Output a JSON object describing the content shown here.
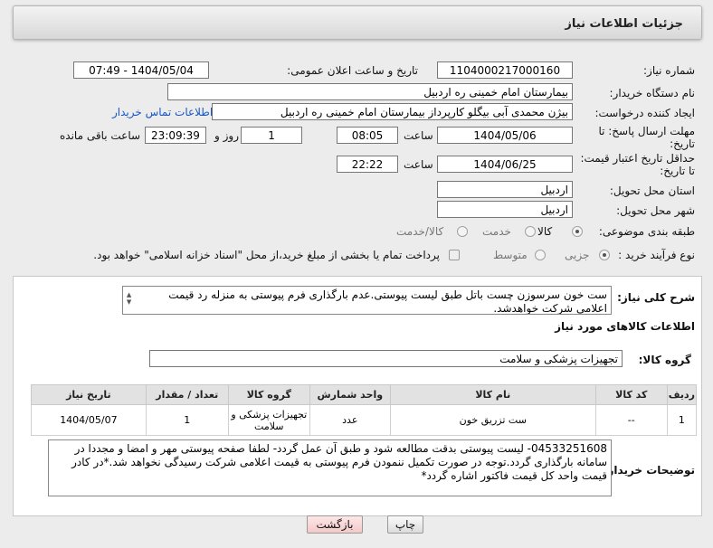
{
  "header": {
    "title": "جزئیات اطلاعات نیاز"
  },
  "fields": {
    "need_number_label": "شماره نیاز:",
    "need_number": "1104000217000160",
    "announce_label": "تاریخ و ساعت اعلان عمومی:",
    "announce_value": "1404/05/04 - 07:49",
    "buyer_org_label": "نام دستگاه خریدار:",
    "buyer_org": "بیمارستان امام خمینی  ره  اردبیل",
    "requester_label": "ایجاد کننده درخواست:",
    "requester": "بیژن محمدی آبی بیگلو کارپرداز بیمارستان امام خمینی  ره  اردبیل",
    "contact_link": "اطلاعات تماس خریدار",
    "reply_deadline_label_1": "مهلت ارسال پاسخ: تا",
    "reply_deadline_label_2": "تاریخ:",
    "reply_date": "1404/05/06",
    "time_label": "ساعت",
    "reply_time": "08:05",
    "days_value": "1",
    "days_label": "روز و",
    "remaining_time": "23:09:39",
    "remaining_label": "ساعت باقی مانده",
    "price_deadline_label_1": "حداقل تاریخ اعتبار قیمت:",
    "price_deadline_label_2": "تا تاریخ:",
    "price_date": "1404/06/25",
    "price_time": "22:22",
    "province_label": "استان محل تحویل:",
    "province": "اردبیل",
    "city_label": "شهر محل تحویل:",
    "city": "اردبیل",
    "category_label": "طبقه بندی موضوعی:",
    "category_options": [
      "کالا",
      "خدمت",
      "کالا/خدمت"
    ],
    "process_label": "نوع فرآیند خرید :",
    "process_options": [
      "جزیی",
      "متوسط"
    ],
    "payment_note": "پرداخت تمام یا بخشی از مبلغ خرید،از محل \"اسناد خزانه اسلامی\" خواهد بود."
  },
  "description": {
    "label": "شرح کلی نیاز:",
    "text": "ست خون سرسوزن چست باتل طبق لیست پیوستی.عدم بارگذاری فرم پیوستی به منزله رد قیمت اعلامی شرکت خواهدشد."
  },
  "goods": {
    "section_title": "اطلاعات کالاهای مورد نیاز",
    "group_label": "گروه کالا:",
    "group_value": "تجهیزات پزشکی و سلامت",
    "columns": [
      "ردیف",
      "کد کالا",
      "نام کالا",
      "واحد شمارش",
      "گروه کالا",
      "تعداد / مقدار",
      "تاریخ نیاز"
    ],
    "rows": [
      [
        "1",
        "--",
        "ست تزریق خون",
        "عدد",
        "تجهیزات پزشکی و سلامت",
        "1",
        "1404/05/07"
      ]
    ]
  },
  "buyer_notes": {
    "label": "توضیحات خریدار:",
    "text": "04533251608- لیست پیوستی بدقت مطالعه شود و طبق آن عمل گردد- لطفا صفحه پیوستی مهر و امضا و مجددا در سامانه بارگذاری گردد.توجه در صورت تکمیل ننمودن فرم پیوستی به قیمت اعلامی شرکت رسیدگی نخواهد شد.*در کادر قیمت واحد کل قیمت فاکتور اشاره گردد*"
  },
  "buttons": {
    "print": "چاپ",
    "back": "بازگشت"
  },
  "colors": {
    "link": "#1a56c4",
    "back_button_bg": "#f9d9d9",
    "panel_bg": "#ffffff"
  }
}
